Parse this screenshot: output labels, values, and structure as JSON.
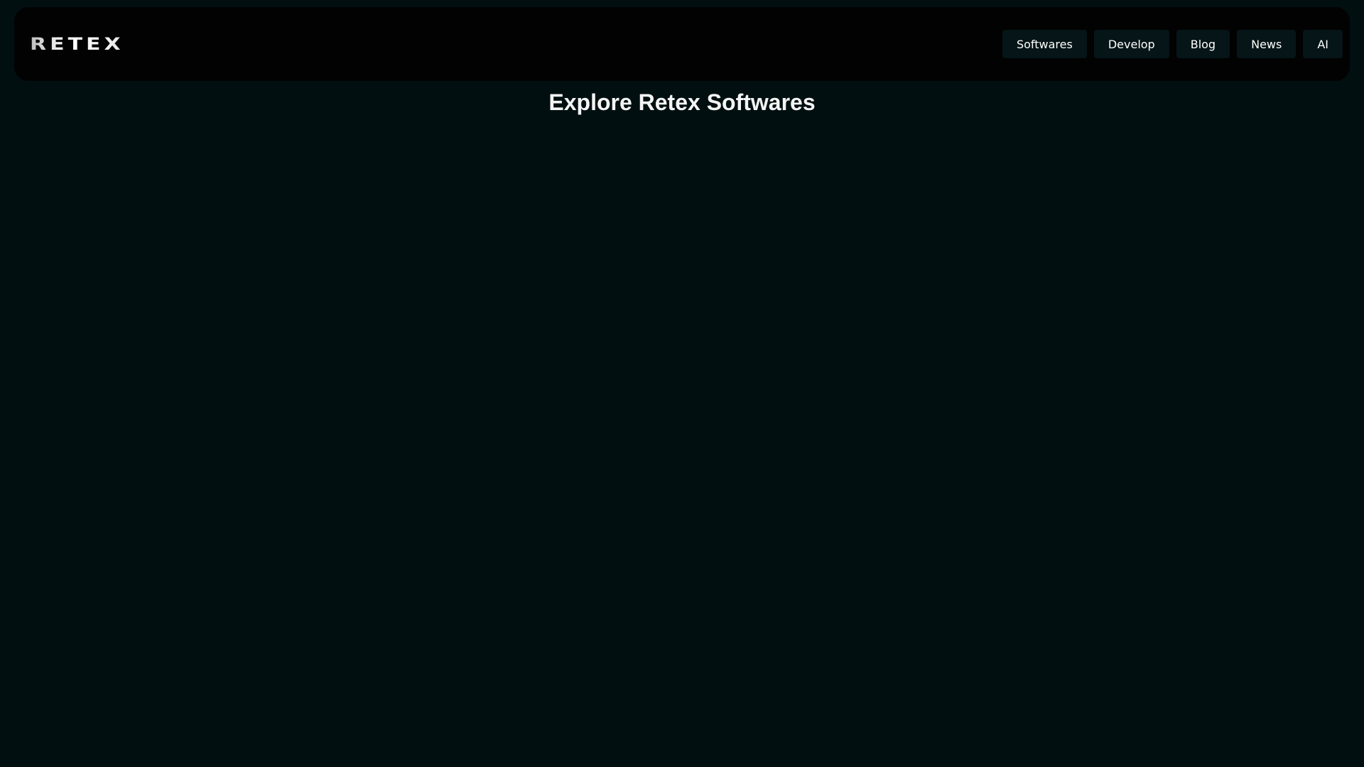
{
  "header": {
    "logo_text": "RETEX",
    "nav": [
      {
        "label": "Softwares"
      },
      {
        "label": "Develop"
      },
      {
        "label": "Blog"
      },
      {
        "label": "News"
      },
      {
        "label": "AI"
      }
    ]
  },
  "main": {
    "title": "Explore Retex Softwares"
  },
  "colors": {
    "background": "#010f10",
    "navbar": "#020202",
    "nav_button": "#061517",
    "text": "#ffffff"
  }
}
